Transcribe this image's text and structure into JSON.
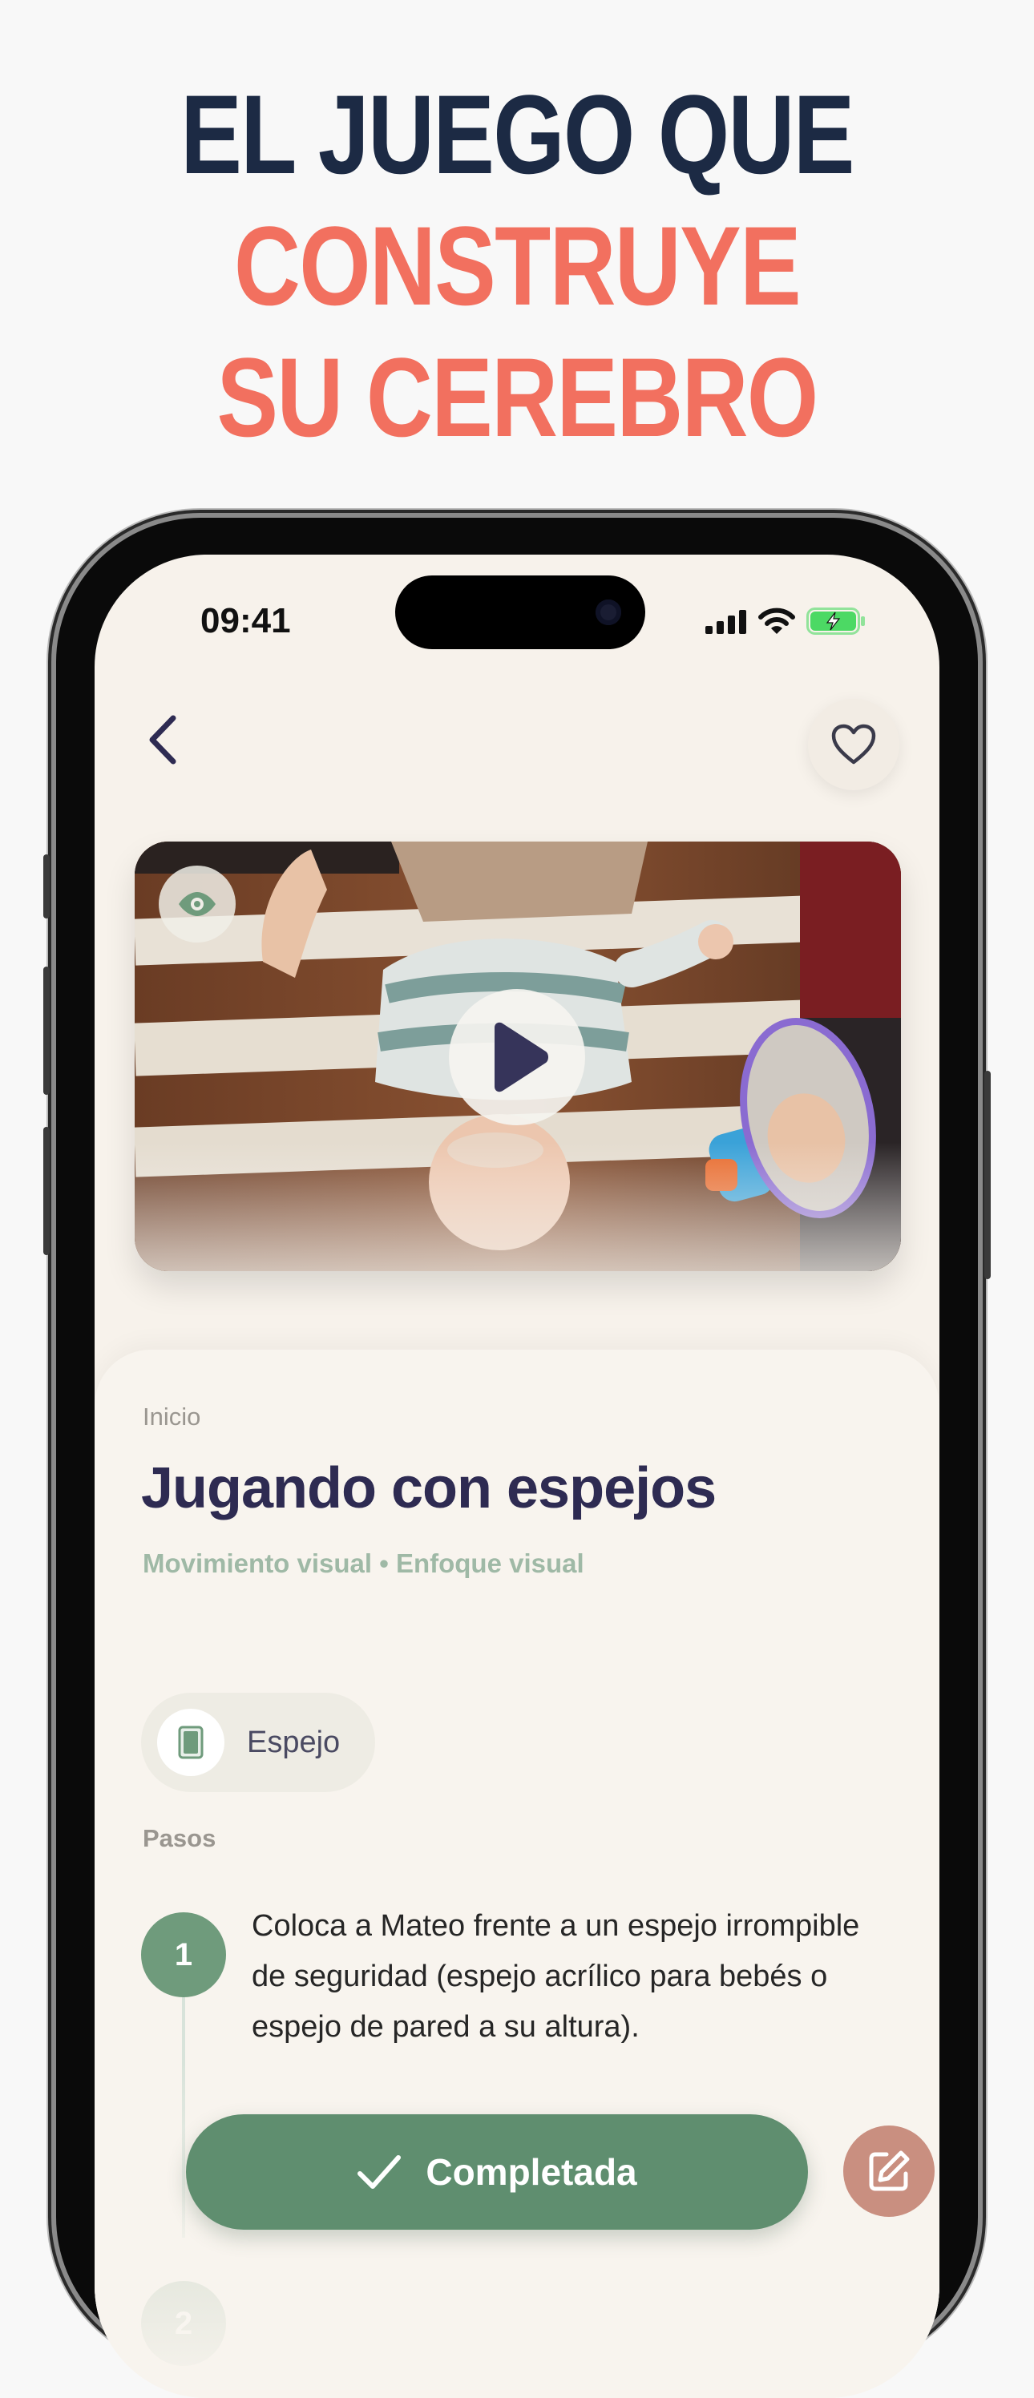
{
  "headline": {
    "line1": "EL JUEGO QUE",
    "line2": "CONSTRUYE",
    "line3": "SU CEREBRO"
  },
  "status_bar": {
    "time": "09:41"
  },
  "nav": {
    "back_icon": "chevron-left-icon",
    "favorite_icon": "heart-icon"
  },
  "video": {
    "view_icon": "eye-icon",
    "play_icon": "play-icon"
  },
  "activity": {
    "breadcrumb": "Inicio",
    "title": "Jugando con espejos",
    "tags": "Movimiento visual • Enfoque visual",
    "materials": [
      {
        "icon": "mirror-icon",
        "label": "Espejo"
      }
    ],
    "steps_label": "Pasos",
    "steps": [
      {
        "number": "1",
        "text": "Coloca a Mateo frente a un espejo irrompible de seguridad (espejo acrílico para bebés o espejo de pared a su altura)."
      },
      {
        "number": "2",
        "text": ""
      }
    ]
  },
  "actions": {
    "complete_label": "Completada",
    "complete_icon": "checkmark-icon",
    "edit_icon": "edit-note-icon"
  },
  "colors": {
    "headline_dark": "#1c2a44",
    "headline_accent": "#f2705f",
    "title": "#2e2b52",
    "tag_green": "#9fb9a6",
    "step_green": "#6f9b7c",
    "cta_green": "#5f8e6f",
    "edit_button": "#c98f80",
    "battery_green": "#4cd964"
  }
}
